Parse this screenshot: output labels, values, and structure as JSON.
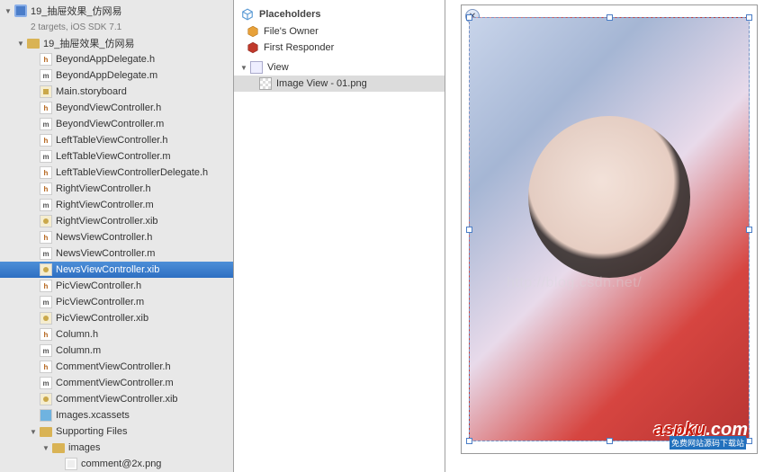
{
  "project": {
    "name": "19_抽屉效果_仿网易",
    "subtitle": "2 targets, iOS SDK 7.1"
  },
  "tree": [
    {
      "indent": 0,
      "disclosure": "open",
      "icon": "project",
      "label": "19_抽屉效果_仿网易",
      "sub": true
    },
    {
      "indent": 1,
      "disclosure": "open",
      "icon": "folder",
      "label": "19_抽屉效果_仿网易"
    },
    {
      "indent": 2,
      "disclosure": "none",
      "icon": "h",
      "label": "BeyondAppDelegate.h"
    },
    {
      "indent": 2,
      "disclosure": "none",
      "icon": "m",
      "label": "BeyondAppDelegate.m"
    },
    {
      "indent": 2,
      "disclosure": "none",
      "icon": "storyboard",
      "label": "Main.storyboard"
    },
    {
      "indent": 2,
      "disclosure": "none",
      "icon": "h",
      "label": "BeyondViewController.h"
    },
    {
      "indent": 2,
      "disclosure": "none",
      "icon": "m",
      "label": "BeyondViewController.m"
    },
    {
      "indent": 2,
      "disclosure": "none",
      "icon": "h",
      "label": "LeftTableViewController.h"
    },
    {
      "indent": 2,
      "disclosure": "none",
      "icon": "m",
      "label": "LeftTableViewController.m"
    },
    {
      "indent": 2,
      "disclosure": "none",
      "icon": "h",
      "label": "LeftTableViewControllerDelegate.h"
    },
    {
      "indent": 2,
      "disclosure": "none",
      "icon": "h",
      "label": "RightViewController.h"
    },
    {
      "indent": 2,
      "disclosure": "none",
      "icon": "m",
      "label": "RightViewController.m"
    },
    {
      "indent": 2,
      "disclosure": "none",
      "icon": "xib",
      "label": "RightViewController.xib"
    },
    {
      "indent": 2,
      "disclosure": "none",
      "icon": "h",
      "label": "NewsViewController.h"
    },
    {
      "indent": 2,
      "disclosure": "none",
      "icon": "m",
      "label": "NewsViewController.m"
    },
    {
      "indent": 2,
      "disclosure": "none",
      "icon": "xib",
      "label": "NewsViewController.xib",
      "selected": true
    },
    {
      "indent": 2,
      "disclosure": "none",
      "icon": "h",
      "label": "PicViewController.h"
    },
    {
      "indent": 2,
      "disclosure": "none",
      "icon": "m",
      "label": "PicViewController.m"
    },
    {
      "indent": 2,
      "disclosure": "none",
      "icon": "xib",
      "label": "PicViewController.xib"
    },
    {
      "indent": 2,
      "disclosure": "none",
      "icon": "h",
      "label": "Column.h"
    },
    {
      "indent": 2,
      "disclosure": "none",
      "icon": "m",
      "label": "Column.m"
    },
    {
      "indent": 2,
      "disclosure": "none",
      "icon": "h",
      "label": "CommentViewController.h"
    },
    {
      "indent": 2,
      "disclosure": "none",
      "icon": "m",
      "label": "CommentViewController.m"
    },
    {
      "indent": 2,
      "disclosure": "none",
      "icon": "xib",
      "label": "CommentViewController.xib"
    },
    {
      "indent": 2,
      "disclosure": "none",
      "icon": "asset",
      "label": "Images.xcassets"
    },
    {
      "indent": 2,
      "disclosure": "open",
      "icon": "folder",
      "label": "Supporting Files"
    },
    {
      "indent": 3,
      "disclosure": "open",
      "icon": "folder",
      "label": "images"
    },
    {
      "indent": 4,
      "disclosure": "none",
      "icon": "png",
      "label": "comment@2x.png"
    }
  ],
  "outline": {
    "header": "Placeholders",
    "owner": "File's Owner",
    "responder": "First Responder",
    "view": "View",
    "imageview": "Image View - 01.png"
  },
  "canvas": {
    "close_glyph": "✕"
  },
  "watermark": {
    "brand": "aspku",
    "suffix": ".com",
    "tagline": "免费网站源码下载站",
    "url": "http://blog.csdn.net/"
  }
}
